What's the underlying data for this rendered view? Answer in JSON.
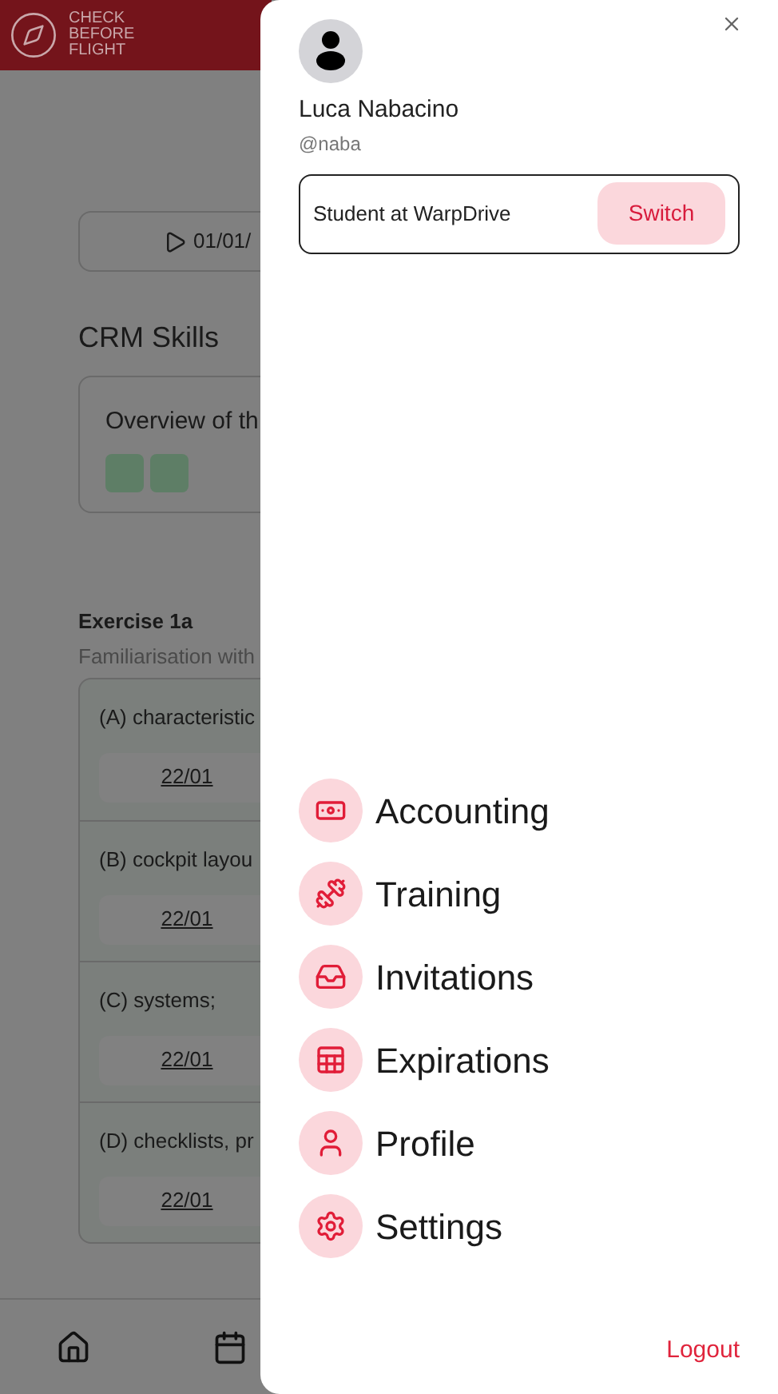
{
  "header": {
    "logo_lines": [
      "CHECK",
      "BEFORE",
      "FLIGHT"
    ]
  },
  "date_button": {
    "label": "01/01/"
  },
  "section_title": "CRM Skills",
  "overview_card": {
    "title": "Overview of th"
  },
  "exercise": {
    "title": "Exercise 1a",
    "subtitle": "Familiarisation with",
    "rows": [
      {
        "label": "(A) characteristic",
        "date": "22/01"
      },
      {
        "label": "(B) cockpit layou",
        "date": "22/01"
      },
      {
        "label": "(C) systems;",
        "date": "22/01"
      },
      {
        "label": "(D) checklists, pr",
        "date": "22/01"
      }
    ]
  },
  "drawer": {
    "user": {
      "name": "Luca Nabacino",
      "handle": "@naba"
    },
    "role": {
      "label": "Student at WarpDrive",
      "button": "Switch"
    },
    "menu": [
      {
        "label": "Accounting"
      },
      {
        "label": "Training"
      },
      {
        "label": "Invitations"
      },
      {
        "label": "Expirations"
      },
      {
        "label": "Profile"
      },
      {
        "label": "Settings"
      }
    ],
    "logout": "Logout"
  }
}
